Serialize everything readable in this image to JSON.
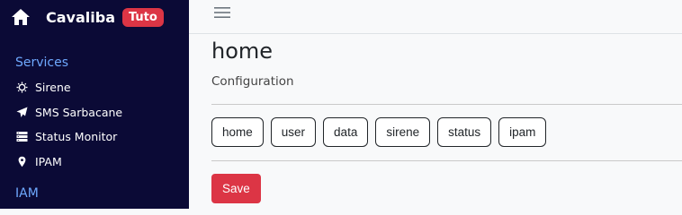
{
  "sidebar": {
    "brand": {
      "name": "Cavaliba",
      "badge": "Tuto",
      "icon": "home-icon"
    },
    "sections": [
      {
        "title": "Services",
        "items": [
          {
            "label": "Sirene",
            "icon": "sun-icon"
          },
          {
            "label": "SMS Sarbacane",
            "icon": "paper-plane-icon"
          },
          {
            "label": "Status Monitor",
            "icon": "server-icon"
          },
          {
            "label": "IPAM",
            "icon": "location-pin-icon"
          }
        ]
      },
      {
        "title": "IAM",
        "items": []
      }
    ]
  },
  "topbar": {
    "menu_icon": "hamburger-icon"
  },
  "main": {
    "title": "home",
    "subtitle": "Configuration",
    "tabs": [
      "home",
      "user",
      "data",
      "sirene",
      "status",
      "ipam"
    ],
    "save_label": "Save"
  },
  "colors": {
    "sidebar_bg": "#0b0a36",
    "section_title": "#6ea8fe",
    "badge_bg": "#dc3545",
    "save_bg": "#dc3545"
  }
}
